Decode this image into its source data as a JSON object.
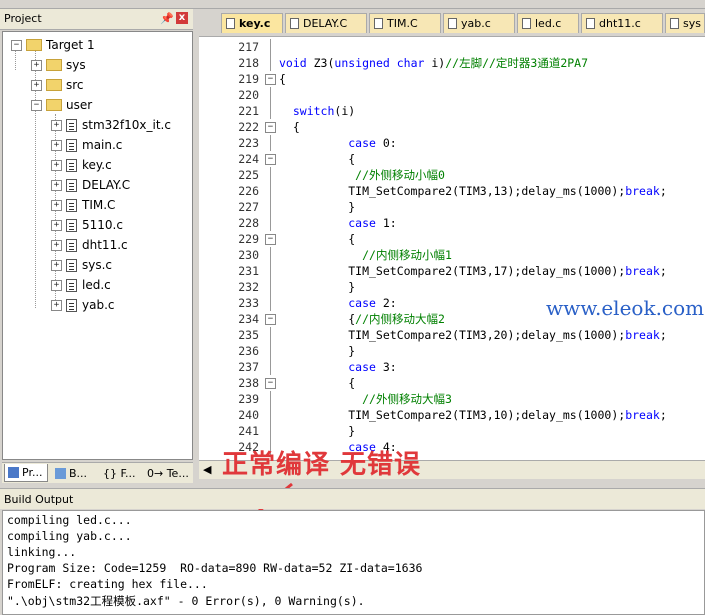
{
  "project_panel": {
    "title": "Project",
    "pin": "ᵖ",
    "close": "x",
    "tree": [
      {
        "label": "Target 1",
        "type": "target"
      },
      {
        "label": "sys",
        "type": "folder"
      },
      {
        "label": "src",
        "type": "folder"
      },
      {
        "label": "user",
        "type": "folder"
      },
      {
        "label": "stm32f10x_it.c",
        "type": "file"
      },
      {
        "label": "main.c",
        "type": "file"
      },
      {
        "label": "key.c",
        "type": "file"
      },
      {
        "label": "DELAY.C",
        "type": "file"
      },
      {
        "label": "TIM.C",
        "type": "file"
      },
      {
        "label": "5110.c",
        "type": "file"
      },
      {
        "label": "dht11.c",
        "type": "file"
      },
      {
        "label": "sys.c",
        "type": "file"
      },
      {
        "label": "led.c",
        "type": "file"
      },
      {
        "label": "yab.c",
        "type": "file"
      }
    ],
    "tabs": [
      "Pr...",
      "B...",
      "{} F...",
      "0→ Te..."
    ]
  },
  "editor": {
    "tabs": [
      "key.c",
      "DELAY.C",
      "TIM.C",
      "yab.c",
      "led.c",
      "dht11.c",
      "sys"
    ],
    "active_tab": "key.c",
    "lines": [
      {
        "n": "217",
        "text": ""
      },
      {
        "n": "218",
        "text": "void Z3(unsigned char i)//左脚//定时器3通道2PA7"
      },
      {
        "n": "219",
        "text": "{"
      },
      {
        "n": "220",
        "text": ""
      },
      {
        "n": "221",
        "text": "  switch(i)"
      },
      {
        "n": "222",
        "text": "  {"
      },
      {
        "n": "223",
        "text": "          case 0:"
      },
      {
        "n": "224",
        "text": "          {"
      },
      {
        "n": "225",
        "text": "           //外侧移动小幅0"
      },
      {
        "n": "226",
        "text": "          TIM_SetCompare2(TIM3,13);delay_ms(1000);break;"
      },
      {
        "n": "227",
        "text": "          }"
      },
      {
        "n": "228",
        "text": "          case 1:"
      },
      {
        "n": "229",
        "text": "          {"
      },
      {
        "n": "230",
        "text": "            //内侧移动小幅1"
      },
      {
        "n": "231",
        "text": "          TIM_SetCompare2(TIM3,17);delay_ms(1000);break;"
      },
      {
        "n": "232",
        "text": "          }"
      },
      {
        "n": "233",
        "text": "          case 2:"
      },
      {
        "n": "234",
        "text": "          {//内侧移动大幅2"
      },
      {
        "n": "235",
        "text": "          TIM_SetCompare2(TIM3,20);delay_ms(1000);break;"
      },
      {
        "n": "236",
        "text": "          }"
      },
      {
        "n": "237",
        "text": "          case 3:"
      },
      {
        "n": "238",
        "text": "          {"
      },
      {
        "n": "239",
        "text": "            //外侧移动大幅3"
      },
      {
        "n": "240",
        "text": "          TIM_SetCompare2(TIM3,10);delay_ms(1000);break;"
      },
      {
        "n": "241",
        "text": "          }"
      },
      {
        "n": "242",
        "text": "          case 4:"
      }
    ]
  },
  "watermark": "www.eleok.com",
  "annotation": "正常编译 无错误",
  "build_output": {
    "title": "Build Output",
    "lines": [
      "compiling led.c...",
      "compiling yab.c...",
      "linking...",
      "Program Size: Code=1259  RO-data=890 RW-data=52 ZI-data=1636",
      "FromELF: creating hex file...",
      "\".\\obj\\stm32工程模板.axf\" - 0 Error(s), 0 Warning(s)."
    ]
  },
  "colors": {
    "keyword": "#0000ff",
    "comment": "#008000",
    "annotation": "#e0383b",
    "watermark": "#2a60c7"
  }
}
